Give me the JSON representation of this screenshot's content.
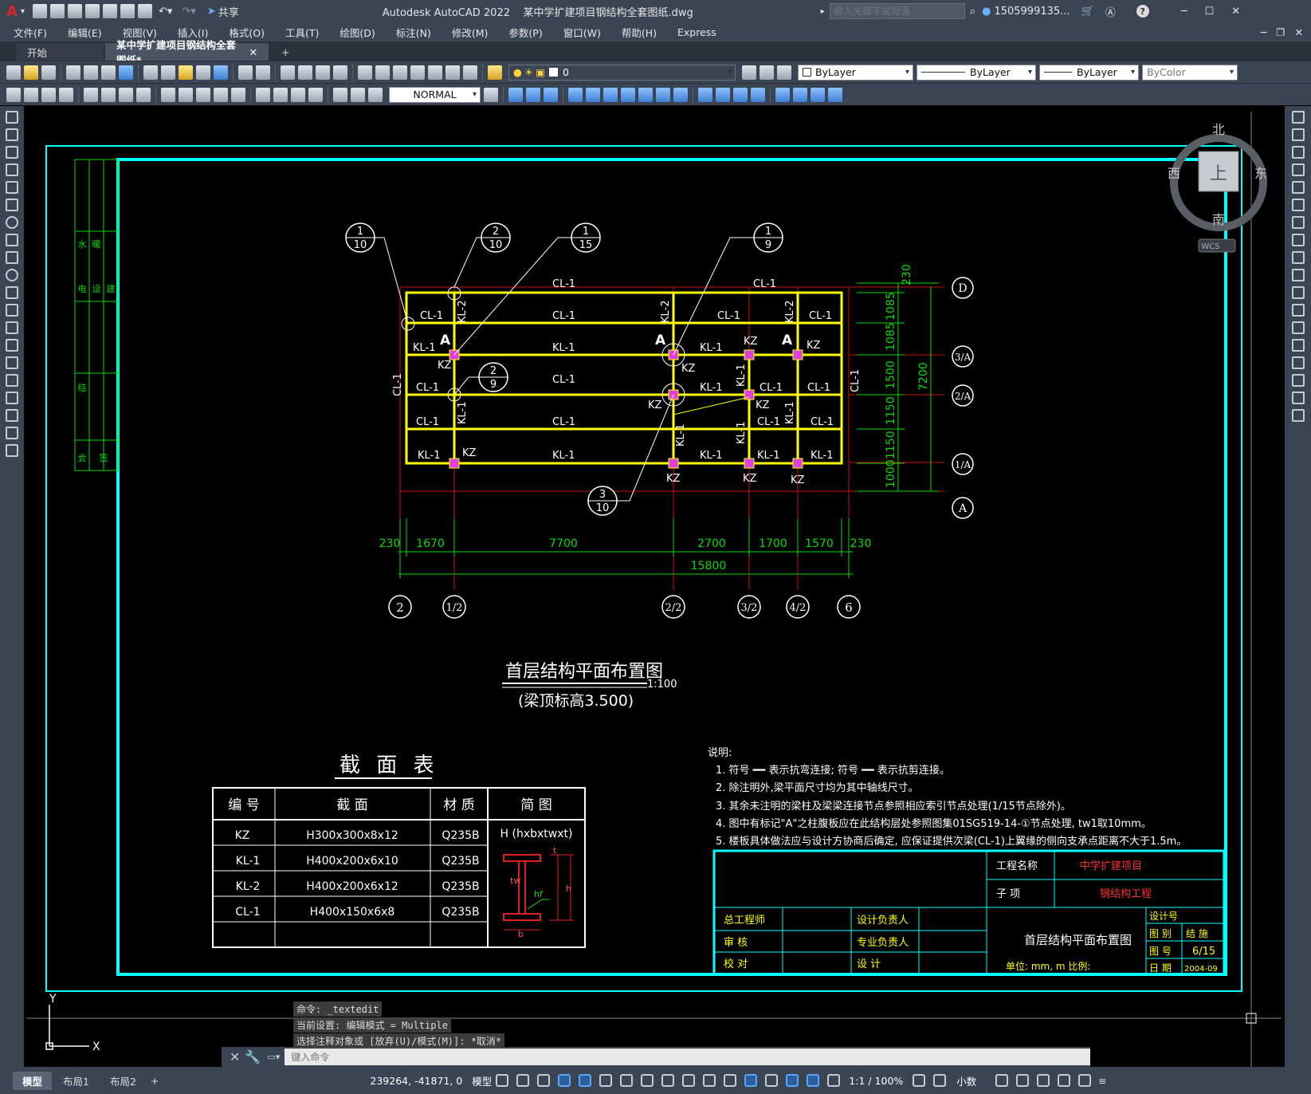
{
  "titlebar": {
    "app_logo": "A",
    "share": "共享",
    "title": "Autodesk AutoCAD 2022    某中学扩建项目钢结构全套图纸.dwg",
    "search_placeholder": "键入关键字或短语",
    "user": "1505999135...",
    "help": "?"
  },
  "menu": [
    "文件(F)",
    "编辑(E)",
    "视图(V)",
    "插入(I)",
    "格式(O)",
    "工具(T)",
    "绘图(D)",
    "标注(N)",
    "修改(M)",
    "参数(P)",
    "窗口(W)",
    "帮助(H)",
    "Express"
  ],
  "file_tabs": [
    {
      "label": "开始"
    },
    {
      "label": "某中学扩建项目钢结构全套图纸*"
    }
  ],
  "toolbar": {
    "layer": "0",
    "color": "ByLayer",
    "linetype": "ByLayer",
    "lineweight": "ByLayer",
    "plotstyle": "ByColor",
    "dimstyle": "NORMAL"
  },
  "viewcube": {
    "north": "北",
    "south": "南",
    "east": "东",
    "west": "西",
    "top": "上",
    "wcs": "WCS"
  },
  "drawing": {
    "cl1": "CL-1",
    "kl1": "KL-1",
    "kl2": "KL-2",
    "kz": "KZ",
    "mark_a": "A",
    "callouts": [
      {
        "t": "1",
        "b": "10"
      },
      {
        "t": "2",
        "b": "10"
      },
      {
        "t": "1",
        "b": "15"
      },
      {
        "t": "1",
        "b": "9"
      },
      {
        "t": "2",
        "b": "9"
      },
      {
        "t": "3",
        "b": "10"
      }
    ],
    "axes_right": [
      "D",
      "3/A",
      "2/A",
      "1/A",
      "A"
    ],
    "axes_bottom": [
      "2",
      "1/2",
      "2/2",
      "3/2",
      "4/2",
      "6"
    ],
    "dims_bottom": [
      "230",
      "1670",
      "7700",
      "2700",
      "1700",
      "1570",
      "230"
    ],
    "dim_total_bottom": "15800",
    "dims_right": [
      "230",
      "1085",
      "1085",
      "1500",
      "1150",
      "1150",
      "1000"
    ],
    "dim_total_right": "7200",
    "plan_title": "首层结构平面布置图",
    "plan_scale": "1:100",
    "plan_subtitle": "(梁顶标高3.500)"
  },
  "section_table": {
    "title": "截 面 表",
    "headers": [
      "编 号",
      "截 面",
      "材 质",
      "简 图"
    ],
    "rows": [
      [
        "KZ",
        "H300x300x8x12",
        "Q235B"
      ],
      [
        "KL-1",
        "H400x200x6x10",
        "Q235B"
      ],
      [
        "KL-2",
        "H400x200x6x12",
        "Q235B"
      ],
      [
        "CL-1",
        "H400x150x6x8",
        "Q235B"
      ]
    ],
    "diagram_label": "H (hxbxtwxt)",
    "diagram_marks": {
      "b": "b",
      "tw": "tw",
      "hf": "hf",
      "h": "h",
      "t": "t"
    }
  },
  "notes": {
    "heading": "说明:",
    "items": [
      "1. 符号 ━━ 表示抗弯连接; 符号 ━━ 表示抗剪连接。",
      "2. 除注明外,梁平面尺寸均为其中轴线尺寸。",
      "3. 其余未注明的梁柱及梁梁连接节点参照相应索引节点处理(1/15节点除外)。",
      "4. 图中有标记\"A\"之柱腹板应在此结构层处参照图集01SG519-14-①节点处理, tw1取10mm。",
      "5. 楼板具体做法应与设计方协商后确定, 应保证提供次梁(CL-1)上翼缘的侧向支承点距离不大于1.5m。"
    ]
  },
  "titleblock": {
    "project_label": "工程名称",
    "project_value": "中学扩建项目",
    "sub_label": "子    项",
    "sub_value": "钢结构工程",
    "roles": [
      "总工程师",
      "审    核",
      "校    对"
    ],
    "roles2": [
      "设计负责人",
      "专业负责人",
      "设    计"
    ],
    "drawing_name": "首层结构平面布置图",
    "unit": "单位: mm, m 比例:",
    "fields": [
      {
        "k": "设计号",
        "v": ""
      },
      {
        "k": "图 别",
        "v": "结 施"
      },
      {
        "k": "图 号",
        "v": "6/15"
      },
      {
        "k": "日 期",
        "v": "2004-09"
      }
    ]
  },
  "side_strip": [
    "电",
    "设",
    "建",
    "水",
    "暖",
    "结",
    "会",
    "签"
  ],
  "ucs": {
    "y": "Y",
    "x": "X"
  },
  "command_history": [
    "命令:  _textedit",
    "当前设置: 编辑模式 = Multiple",
    "选择注释对象或 [放弃(U)/模式(M)]: *取消*"
  ],
  "command_placeholder": "键入命令",
  "status": {
    "tabs": [
      "模型",
      "布局1",
      "布局2"
    ],
    "coords": "239264, -41871, 0",
    "model": "模型",
    "scale": "1:1 / 100%",
    "units": "小数"
  }
}
